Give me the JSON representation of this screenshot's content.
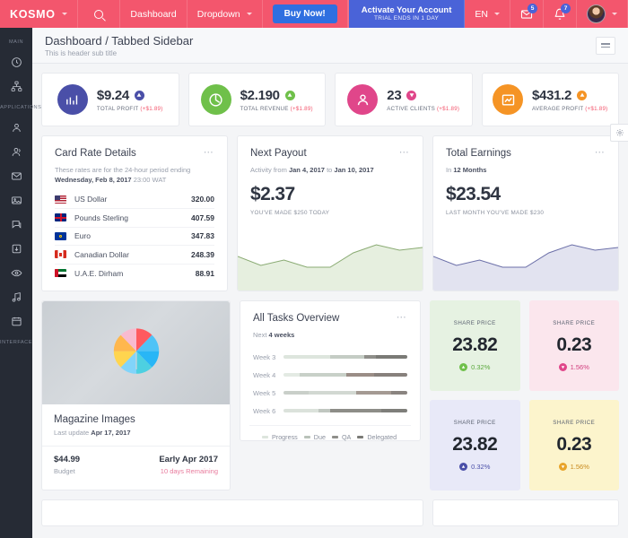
{
  "topbar": {
    "logo": "KOSMO",
    "search_icon": "search-icon",
    "nav": [
      {
        "label": "Dashboard",
        "has_caret": false
      },
      {
        "label": "Dropdown",
        "has_caret": true
      }
    ],
    "buy_now": "Buy Now!",
    "activate": {
      "title": "Activate Your Account",
      "subtitle": "TRIAL ENDS IN 1 DAY"
    },
    "language": "EN",
    "mail_badge": "5",
    "bell_badge": "7"
  },
  "sidebar": {
    "sections": [
      {
        "label": "MAIN",
        "items": [
          {
            "name": "sidebar-item-dashboard",
            "icon": "clock-icon"
          },
          {
            "name": "sidebar-item-network",
            "icon": "network-icon"
          }
        ]
      },
      {
        "label": "APPLICATIONS",
        "items": [
          {
            "name": "sidebar-item-user",
            "icon": "user-icon"
          },
          {
            "name": "sidebar-item-users",
            "icon": "users-icon"
          },
          {
            "name": "sidebar-item-mail",
            "icon": "mail-icon"
          },
          {
            "name": "sidebar-item-gallery",
            "icon": "image-icon"
          },
          {
            "name": "sidebar-item-chat",
            "icon": "chat-icon"
          },
          {
            "name": "sidebar-item-download",
            "icon": "download-icon"
          },
          {
            "name": "sidebar-item-eye",
            "icon": "eye-icon"
          },
          {
            "name": "sidebar-item-music",
            "icon": "music-icon"
          },
          {
            "name": "sidebar-item-calendar",
            "icon": "calendar-icon"
          }
        ]
      },
      {
        "label": "INTERFACE",
        "items": []
      }
    ]
  },
  "page_header": {
    "title": "Dashboard / Tabbed Sidebar",
    "subtitle": "This is header sub title",
    "menu_icon": "hamburger-icon"
  },
  "stats": [
    {
      "value": "$9.24",
      "label": "TOTAL PROFIT",
      "delta": "(+$1.89)",
      "color": "#4a4fa8",
      "icon": "bar-chart-icon",
      "trend": "up"
    },
    {
      "value": "$2.190",
      "label": "TOTAL REVENUE",
      "delta": "(+$1.89)",
      "color": "#6fc04a",
      "icon": "pie-chart-icon",
      "trend": "up"
    },
    {
      "value": "23",
      "label": "ACTIVE CLIENTS",
      "delta": "(+$1.89)",
      "color": "#e0468a",
      "icon": "person-icon",
      "trend": "down"
    },
    {
      "value": "$431.2",
      "label": "AVERAGE PROFIT",
      "delta": "(+$1.89)",
      "color": "#f59425",
      "icon": "chart-box-icon",
      "trend": "up"
    }
  ],
  "card_rates": {
    "title": "Card Rate Details",
    "subtitle_1": "These rates are for the 24-hour period ending",
    "subtitle_2_bold": "Wednesday, Feb 8, 2017",
    "subtitle_2_rest": "23:00 WAT",
    "menu_icon": "more-icon",
    "rows": [
      {
        "flag": "us",
        "name": "US Dollar",
        "value": "320.00"
      },
      {
        "flag": "gb",
        "name": "Pounds Sterling",
        "value": "407.59"
      },
      {
        "flag": "eu",
        "name": "Euro",
        "value": "347.83"
      },
      {
        "flag": "ca",
        "name": "Canadian Dollar",
        "value": "248.39"
      },
      {
        "flag": "ae",
        "name": "U.A.E. Dirham",
        "value": "88.91"
      }
    ]
  },
  "next_payout": {
    "title": "Next Payout",
    "sub_pre": "Activity from",
    "sub_from": "Jan 4, 2017",
    "sub_mid": "to",
    "sub_to": "Jan 10, 2017",
    "amount": "$2.37",
    "note": "YOU'VE MADE $250 TODAY",
    "menu_icon": "more-icon",
    "chart_color": "#8aab73",
    "chart_fill": "#e6efdf"
  },
  "total_earnings": {
    "title": "Total Earnings",
    "sub_pre": "In",
    "sub_bold": "12 Months",
    "amount": "$23.54",
    "note": "LAST MONTH YOU'VE MADE $230",
    "menu_icon": "more-icon",
    "chart_color": "#6b6fa8",
    "chart_fill": "#e2e3f0"
  },
  "magazine": {
    "title": "Magazine Images",
    "sub_pre": "Last update",
    "sub_bold": "Apr 17, 2017",
    "budget_value": "$44.99",
    "budget_label": "Budget",
    "date_value": "Early Apr 2017",
    "date_label": "10 days Remaining",
    "image_alt": "umbrella-photo"
  },
  "tasks": {
    "title": "All Tasks Overview",
    "sub_pre": "Next",
    "sub_bold": "4 weeks",
    "menu_icon": "more-icon",
    "legend": [
      {
        "label": "Progress",
        "color": "#dde5dd"
      },
      {
        "label": "Due",
        "color": "#b9c2b9"
      },
      {
        "label": "QA",
        "color": "#8f8f8a"
      },
      {
        "label": "Delegated",
        "color": "#7a7a76"
      }
    ],
    "rows": [
      {
        "label": "Week 3",
        "segments": [
          38,
          27,
          10,
          25
        ]
      },
      {
        "label": "Week 4",
        "segments": [
          13,
          38,
          22,
          27
        ]
      },
      {
        "label": "Week 5",
        "segments": [
          20,
          39,
          28,
          13
        ]
      },
      {
        "label": "Week 6",
        "segments": [
          28,
          10,
          41,
          21
        ]
      }
    ]
  },
  "share_cards": [
    {
      "label": "SHARE PRICE",
      "value": "23.82",
      "pct": "0.32%",
      "trend": "up",
      "bg": "#e6f2e2",
      "dot": "#6fc04a",
      "pct_color": "#5aa83c"
    },
    {
      "label": "SHARE PRICE",
      "value": "0.23",
      "pct": "1.56%",
      "trend": "down",
      "bg": "#fbe6ed",
      "dot": "#e0468a",
      "pct_color": "#d13d7d"
    },
    {
      "label": "SHARE PRICE",
      "value": "23.82",
      "pct": "0.32%",
      "trend": "up",
      "bg": "#e8e9f8",
      "dot": "#4a4fa8",
      "pct_color": "#4a4fa8"
    },
    {
      "label": "SHARE PRICE",
      "value": "0.23",
      "pct": "1.56%",
      "trend": "down",
      "bg": "#fcf4cc",
      "dot": "#e8a42a",
      "pct_color": "#c98a1e"
    }
  ],
  "settings": {
    "icon": "gear-icon"
  },
  "chart_data": [
    {
      "type": "area",
      "title": "Next Payout",
      "x": [
        0,
        1,
        2,
        3,
        4,
        5,
        6,
        7,
        8
      ],
      "values": [
        62,
        46,
        58,
        44,
        44,
        70,
        84,
        74,
        78
      ],
      "ylim": [
        0,
        100
      ],
      "color": "#8aab73"
    },
    {
      "type": "area",
      "title": "Total Earnings",
      "x": [
        0,
        1,
        2,
        3,
        4,
        5,
        6,
        7,
        8
      ],
      "values": [
        62,
        46,
        58,
        44,
        44,
        70,
        84,
        74,
        78
      ],
      "ylim": [
        0,
        100
      ],
      "color": "#6b6fa8"
    },
    {
      "type": "bar",
      "title": "All Tasks Overview",
      "orientation": "horizontal",
      "stacked": true,
      "categories": [
        "Week 3",
        "Week 4",
        "Week 5",
        "Week 6"
      ],
      "series": [
        {
          "name": "Progress",
          "values": [
            38,
            13,
            20,
            28
          ]
        },
        {
          "name": "Due",
          "values": [
            27,
            38,
            39,
            10
          ]
        },
        {
          "name": "QA",
          "values": [
            10,
            22,
            28,
            41
          ]
        },
        {
          "name": "Delegated",
          "values": [
            25,
            27,
            13,
            21
          ]
        }
      ],
      "xlabel": "",
      "ylabel": "",
      "legend": "bottom"
    }
  ]
}
